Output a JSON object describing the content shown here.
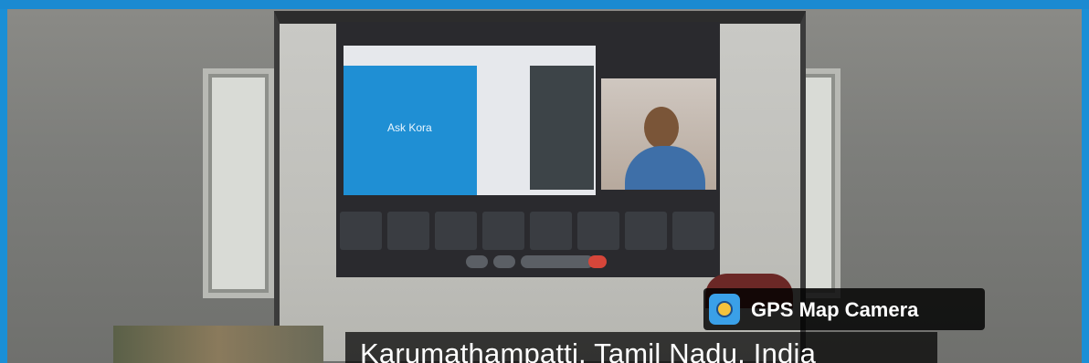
{
  "watermark": {
    "app_name": "GPS Map Camera",
    "icon": "gps-map-camera-logo-icon"
  },
  "location": {
    "place": "Karumathampatti, Tamil Nadu, India"
  },
  "projected_screen": {
    "brand_text": "Ask Kora"
  },
  "colors": {
    "frame": "#1b8ad1",
    "badge_bg": "#000000",
    "badge_text": "#ffffff"
  }
}
